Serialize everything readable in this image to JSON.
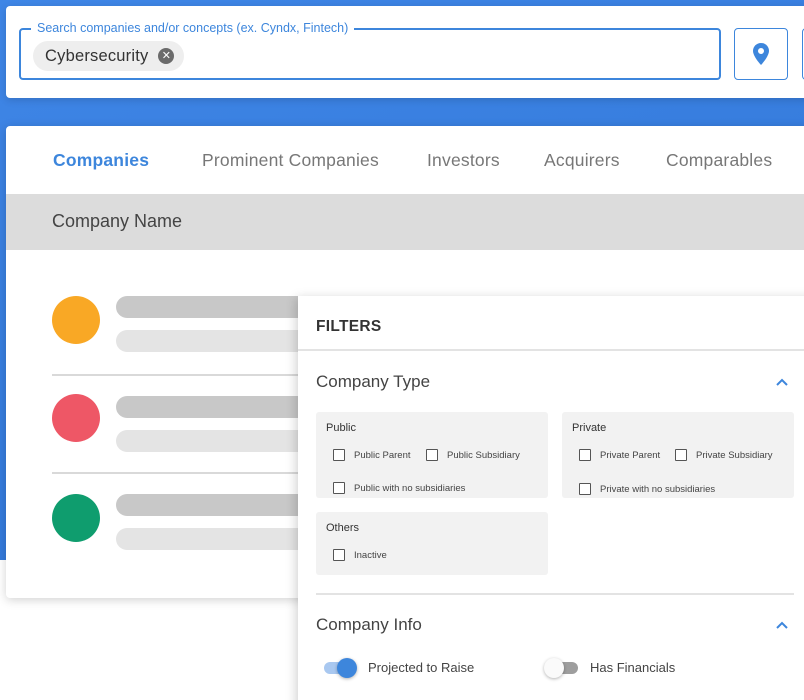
{
  "colors": {
    "accent": "#3d86dc",
    "backdrop": "#3a80e0",
    "dot_orange": "#f9a825",
    "dot_red": "#ee5766",
    "dot_green": "#0f9d6e"
  },
  "search": {
    "legend": "Search companies and/or concepts (ex. Cyndx, Fintech)",
    "chip_label": "Cybersecurity",
    "chip_remove_icon": "close-icon",
    "location_icon": "map-pin-icon"
  },
  "tabs": [
    {
      "label": "Companies",
      "active": true
    },
    {
      "label": "Prominent Companies",
      "active": false
    },
    {
      "label": "Investors",
      "active": false
    },
    {
      "label": "Acquirers",
      "active": false
    },
    {
      "label": "Comparables",
      "active": false
    }
  ],
  "table": {
    "column_header": "Company Name"
  },
  "filters": {
    "title": "FILTERS",
    "company_type": {
      "title": "Company Type",
      "public": {
        "label": "Public",
        "options": [
          "Public Parent",
          "Public Subsidiary",
          "Public with no subsidiaries"
        ]
      },
      "private": {
        "label": "Private",
        "options": [
          "Private Parent",
          "Private Subsidiary",
          "Private with no subsidiaries"
        ]
      },
      "others": {
        "label": "Others",
        "options": [
          "Inactive"
        ]
      }
    },
    "company_info": {
      "title": "Company Info",
      "toggles": [
        {
          "label": "Projected to Raise",
          "on": true
        },
        {
          "label": "Has Financials",
          "on": false
        }
      ]
    }
  }
}
